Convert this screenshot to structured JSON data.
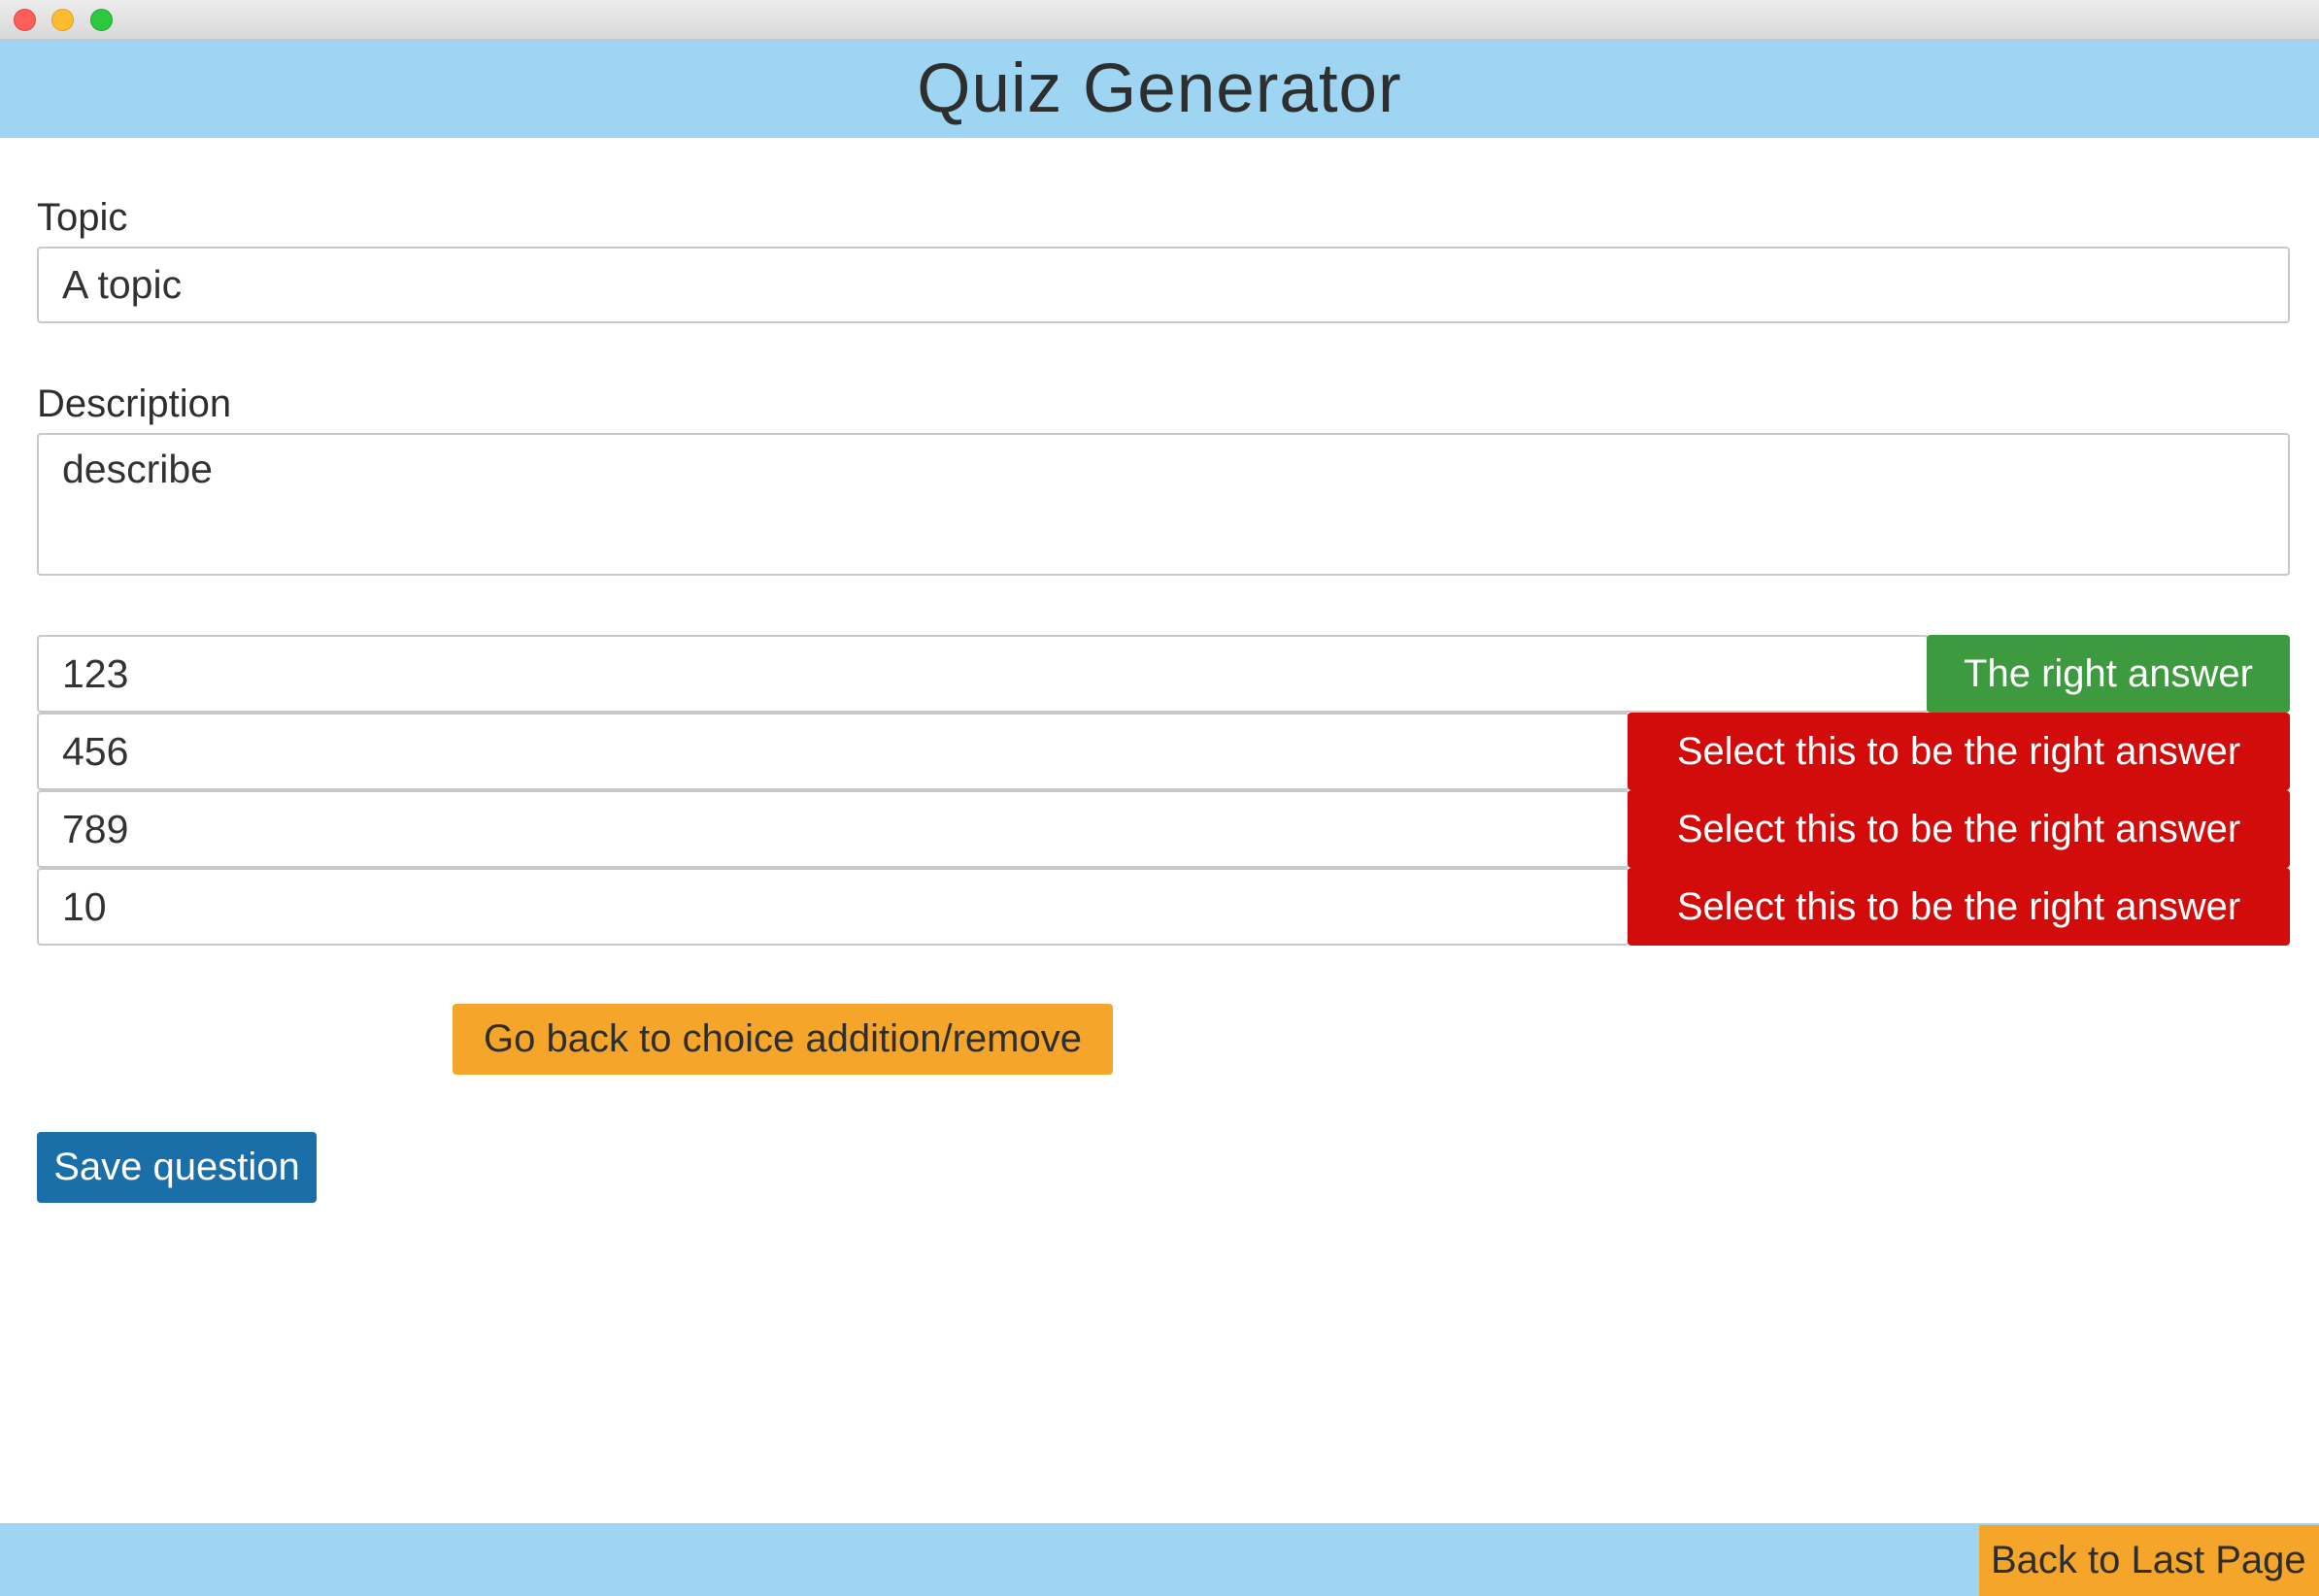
{
  "window": {
    "controls": [
      "close",
      "minimize",
      "zoom"
    ]
  },
  "header": {
    "title": "Quiz Generator"
  },
  "form": {
    "topic": {
      "label": "Topic",
      "value": "A topic"
    },
    "description": {
      "label": "Description",
      "value": "describe"
    },
    "choices": [
      {
        "value": "123",
        "button_label": "The right answer",
        "is_correct": true
      },
      {
        "value": "456",
        "button_label": "Select this to be the right answer",
        "is_correct": false
      },
      {
        "value": "789",
        "button_label": "Select this to be the right answer",
        "is_correct": false
      },
      {
        "value": "10",
        "button_label": "Select this to be the right answer",
        "is_correct": false
      }
    ],
    "back_to_choices_label": "Go back to choice addition/remove",
    "save_label": "Save question"
  },
  "footer": {
    "back_label": "Back to Last Page"
  },
  "colors": {
    "header_bg": "#9dd5f2",
    "correct": "#3e9a3e",
    "incorrect": "#d20b0b",
    "warning": "#f4a52a",
    "primary": "#1b6fa8"
  }
}
